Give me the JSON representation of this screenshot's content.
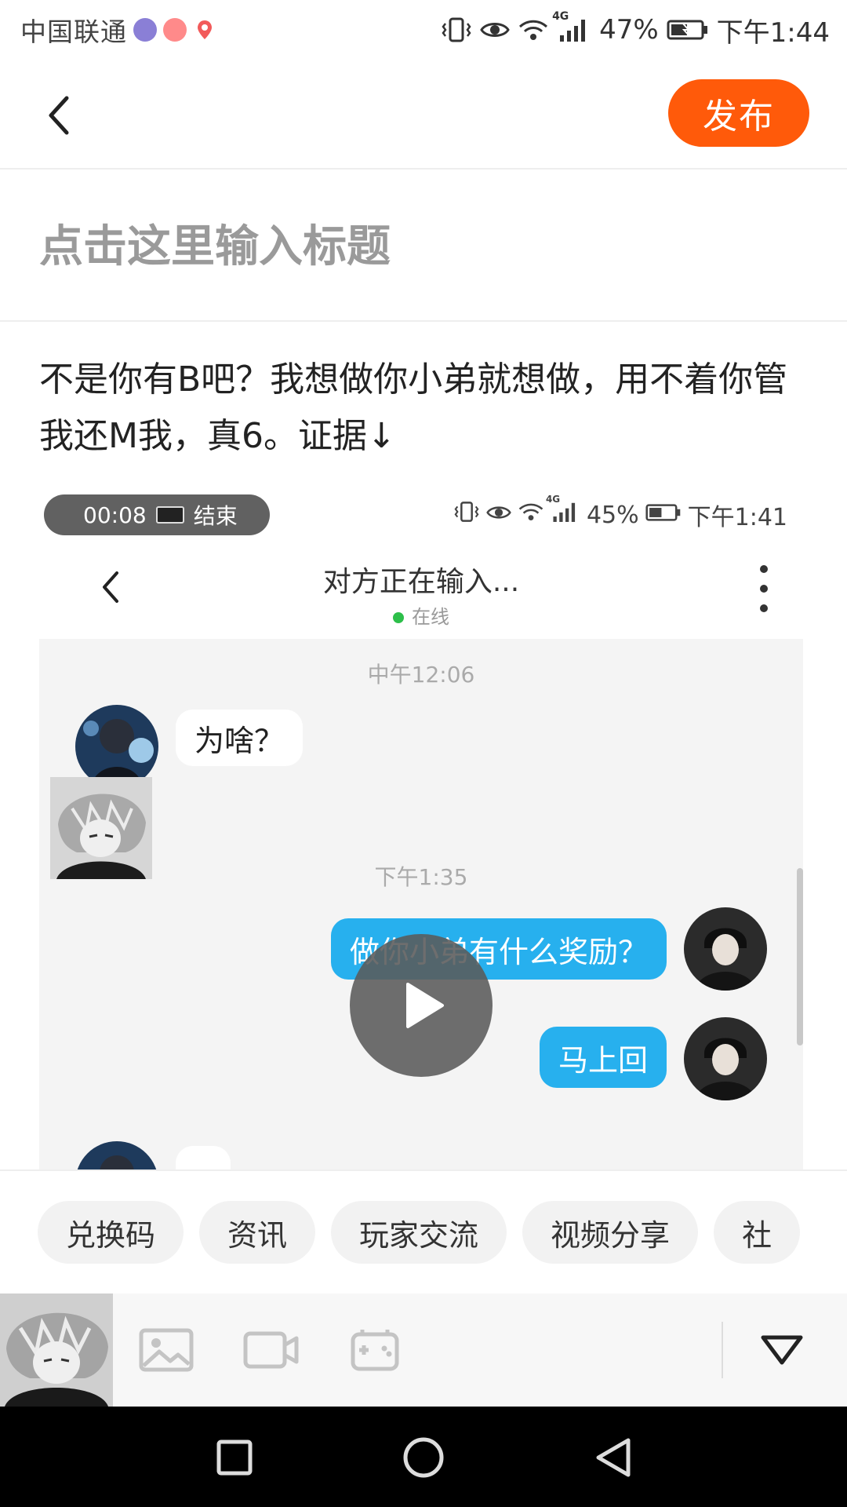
{
  "status_bar": {
    "carrier": "中国联通",
    "battery": "47%",
    "time": "下午1:44",
    "network": "4G"
  },
  "header": {
    "publish_label": "发布"
  },
  "title_input": {
    "placeholder": "点击这里输入标题",
    "value": ""
  },
  "body": {
    "text": "不是你有B吧？我想做你小弟就想做，用不着你管我还M我，真6。证据↓"
  },
  "embedded": {
    "status": {
      "recording_time": "00:08",
      "recording_end": "结束",
      "battery": "45%",
      "time": "下午1:41",
      "network": "4G"
    },
    "chat_header": {
      "title": "对方正在输入...",
      "presence": "在线"
    },
    "messages": {
      "ts1": "中午12:06",
      "m1": "为啥？",
      "ts2": "下午1:35",
      "m2": "做你小弟有什么奖励？",
      "m3": "马上回"
    }
  },
  "tags": [
    "兑换码",
    "资讯",
    "玩家交流",
    "视频分享",
    "社"
  ],
  "colors": {
    "accent": "#ff5a0a",
    "bubble_right": "#27b0ee",
    "online_dot": "#2dbf4a"
  },
  "icons": {
    "toolbar": [
      "image-icon",
      "video-icon",
      "gamepad-icon",
      "collapse-icon"
    ],
    "nav": [
      "recent-apps-icon",
      "home-icon",
      "back-icon"
    ]
  }
}
